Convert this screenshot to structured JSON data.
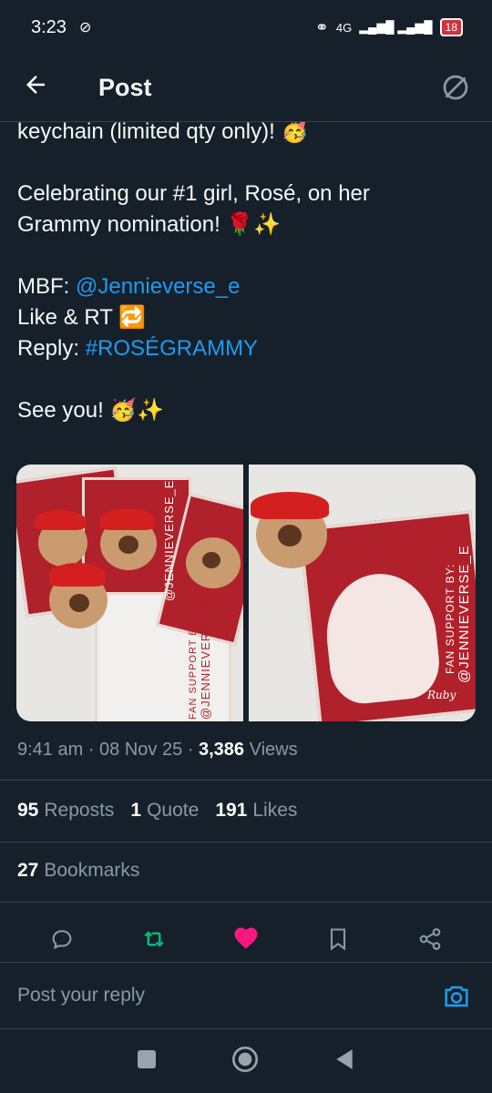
{
  "status_bar": {
    "time": "3:23",
    "network": "4G",
    "battery": "18"
  },
  "header": {
    "title": "Post"
  },
  "tweet": {
    "lines": [
      "keychain (limited qty only)! 🥳",
      "",
      "Celebrating our #1 girl, Rosé, on her",
      "Grammy nomination! 🌹✨",
      "",
      "MBF:",
      "Like & RT 🔁",
      "Reply:",
      "",
      "See you! 🥳✨"
    ],
    "mbf_label": "MBF: ",
    "mbf_handle": "@Jennieverse_e",
    "reply_label": "Reply: ",
    "reply_hashtag": "#ROSÉGRAMMY",
    "card_text": "FAN SUPPORT BY:",
    "card_handle": "@JENNIEVERSE_E",
    "card_sign": "Ruby"
  },
  "meta": {
    "time": "9:41 am",
    "date": "08 Nov 25",
    "views_count": "3,386",
    "views_label": "Views"
  },
  "stats": {
    "reposts_count": "95",
    "reposts_label": "Reposts",
    "quotes_count": "1",
    "quotes_label": "Quote",
    "likes_count": "191",
    "likes_label": "Likes",
    "bookmarks_count": "27",
    "bookmarks_label": "Bookmarks"
  },
  "reply_bar": {
    "placeholder": "Post your reply"
  },
  "colors": {
    "background": "#15202b",
    "link": "#1d9bf0",
    "repost": "#00ba7c",
    "like": "#f91880",
    "muted": "#8b98a5"
  }
}
